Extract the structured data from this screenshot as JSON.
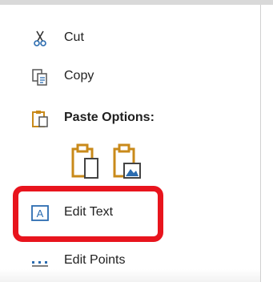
{
  "context_menu": {
    "items": [
      {
        "label": "Cut",
        "icon": "scissors-icon",
        "bold": false
      },
      {
        "label": "Copy",
        "icon": "copy-icon",
        "bold": false
      },
      {
        "label": "Paste Options:",
        "icon": "clipboard-icon",
        "bold": true
      },
      {
        "label": "Edit Text",
        "icon": "edit-text-icon",
        "bold": false
      },
      {
        "label": "Edit Points",
        "icon": "edit-points-icon",
        "bold": false
      }
    ],
    "paste_options": [
      {
        "icon": "paste-keep-formatting-icon"
      },
      {
        "icon": "paste-picture-icon"
      }
    ],
    "highlighted_item": "Edit Text"
  },
  "colors": {
    "highlight": "#e8141d",
    "clipboard_gold": "#c98a1a",
    "icon_blue": "#2b6cb0",
    "text": "#1f1f1f"
  }
}
